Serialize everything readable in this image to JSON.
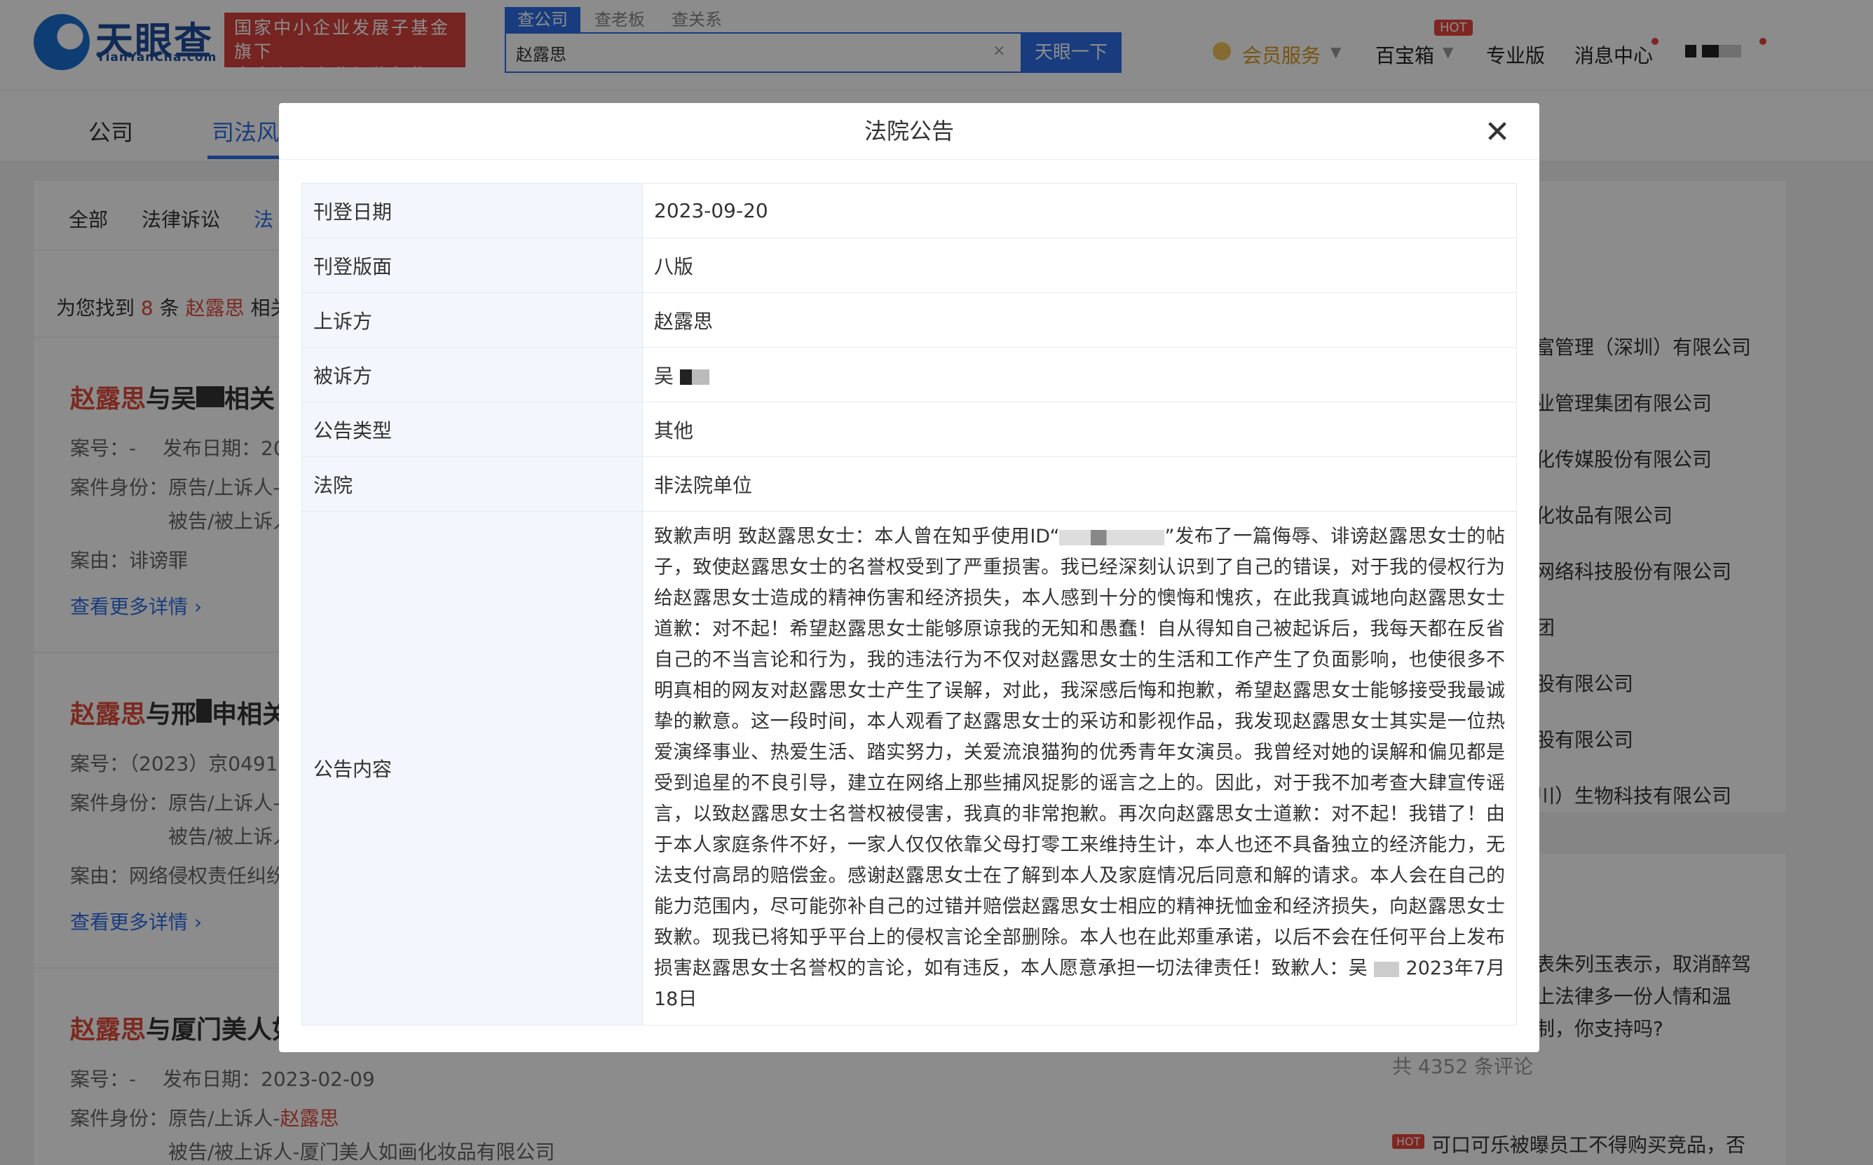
{
  "header": {
    "logo_cn": "天眼查",
    "logo_en": "TianYanCha.com",
    "badge_line1": "国家中小企业发展子基金旗下",
    "badge_line2": "官方备案企业征信机构",
    "search_tabs": [
      "查公司",
      "查老板",
      "查关系"
    ],
    "search_value": "赵露思",
    "search_clear": "×",
    "search_button": "天眼一下",
    "nav": {
      "vip": "会员服务",
      "toolbox": "百宝箱",
      "hot": "HOT",
      "pro": "专业版",
      "messages": "消息中心"
    }
  },
  "page": {
    "main_tabs": [
      "公司",
      "司法风"
    ],
    "sub_tabs": [
      "全部",
      "法律诉讼",
      "法"
    ],
    "found_prefix": "为您找到",
    "found_count": "8",
    "found_mid": "条",
    "found_name": "赵露思",
    "found_suffix": "相关",
    "cards": [
      {
        "title_name": "赵露思",
        "title_rest": "与吴",
        "title_tail": "相关",
        "case_no": "案号：-",
        "publish": "发布日期：20",
        "role_label": "案件身份：",
        "role_1": "原告/上诉人-",
        "role_2": "被告/被上诉人",
        "cause": "案由：诽谤罪",
        "more": "查看更多详情"
      },
      {
        "title_name": "赵露思",
        "title_rest": "与邢",
        "title_tail": "申相关",
        "case_no": "案号：（2023）京0491",
        "role_label": "案件身份：",
        "role_1": "原告/上诉人-",
        "role_2": "被告/被上诉人",
        "cause": "案由：网络侵权责任纠纷",
        "more": "查看更多详情"
      },
      {
        "title_name": "赵露思",
        "title_rest": "与厦门美人如",
        "case_no": "案号：-",
        "publish": "发布日期：2023-02-09",
        "role_label": "案件身份：",
        "role_1": "原告/上诉人-",
        "role_1_name": "赵露思",
        "role_2": "被告/被上诉人-厦门美人如画化妆品有限公司"
      }
    ],
    "right_items": [
      "富管理（深圳）有限公司",
      "业管理集团有限公司",
      "化传媒股份有限公司",
      "化妆品有限公司",
      "网络科技股份有限公司",
      "团",
      "股有限公司",
      "股有限公司",
      "川）生物科技有限公司"
    ],
    "news": {
      "lines": [
        "表朱列玉表示，取消醉驾",
        "上法律多一份人情和温",
        "制，你支持吗?"
      ],
      "comment_count": "共 4352 条评论",
      "hot": "HOT",
      "headline2": "可口可乐被曝员工不得购买竞品，否"
    }
  },
  "modal": {
    "title": "法院公告",
    "rows": [
      {
        "key": "刊登日期",
        "value": "2023-09-20"
      },
      {
        "key": "刊登版面",
        "value": "八版"
      },
      {
        "key": "上诉方",
        "value": "赵露思"
      },
      {
        "key": "被诉方",
        "value": "吴"
      },
      {
        "key": "公告类型",
        "value": "其他"
      },
      {
        "key": "法院",
        "value": "非法院单位"
      }
    ],
    "content_key": "公告内容",
    "content_part1": "致歉声明 致赵露思女士：本人曾在知乎使用ID“",
    "content_part2": "”发布了一篇侮辱、诽谤赵露思女士的帖子，致使赵露思女士的名誉权受到了严重损害。我已经深刻认识到了自己的错误，对于我的侵权行为给赵露思女士造成的精神伤害和经济损失，本人感到十分的懊悔和愧疚，在此我真诚地向赵露思女士道歉：对不起！希望赵露思女士能够原谅我的无知和愚蠢！自从得知自己被起诉后，我每天都在反省自己的不当言论和行为，我的违法行为不仅对赵露思女士的生活和工作产生了负面影响，也使很多不明真相的网友对赵露思女士产生了误解，对此，我深感后悔和抱歉，希望赵露思女士能够接受我最诚挚的歉意。这一段时间，本人观看了赵露思女士的采访和影视作品，我发现赵露思女士其实是一位热爱演绎事业、热爱生活、踏实努力，关爱流浪猫狗的优秀青年女演员。我曾经对她的误解和偏见都是受到追星的不良引导，建立在网络上那些捕风捉影的谣言之上的。因此，对于我不加考查大肆宣传谣言，以致赵露思女士名誉权被侵害，我真的非常抱歉。再次向赵露思女士道歉：对不起！我错了！由于本人家庭条件不好，一家人仅仅依靠父母打零工来维持生计，本人也还不具备独立的经济能力，无法支付高昂的赔偿金。感谢赵露思女士在了解到本人及家庭情况后同意和解的请求。本人会在自己的能力范围内，尽可能弥补自己的过错并赔偿赵露思女士相应的精神抚恤金和经济损失，向赵露思女士致歉。现我已将知乎平台上的侵权言论全部删除。本人也在此郑重承诺，以后不会在任何平台上发布损害赵露思女士名誉权的言论，如有违反，本人愿意承担一切法律责任！致歉人：吴",
    "content_date": "2023年7月18日"
  }
}
